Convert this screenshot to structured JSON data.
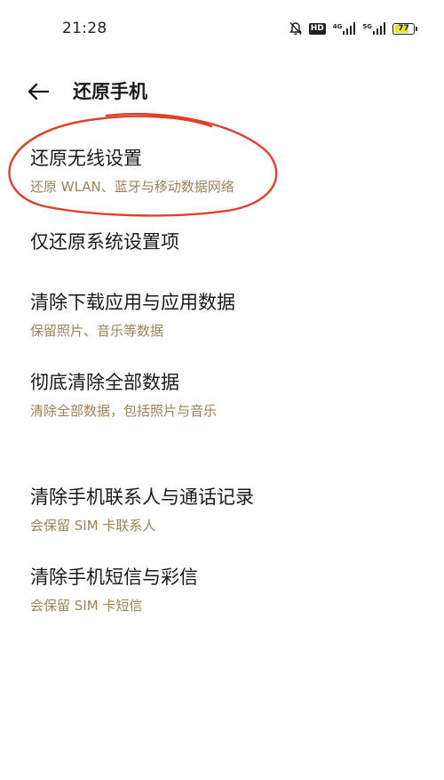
{
  "status_bar": {
    "time": "21:28",
    "hd_label": "HD",
    "net1_label": "4G",
    "net2_label": "5G",
    "battery_level": "77",
    "battery_fraction": 0.77,
    "battery_color": "#e8e432",
    "icons": [
      "bell-mute-icon",
      "hd-icon",
      "signal-4g-icon",
      "signal-5g-icon",
      "battery-icon"
    ]
  },
  "header": {
    "back_icon": "arrow-left-icon",
    "title": "还原手机"
  },
  "items": [
    {
      "title": "还原无线设置",
      "subtitle": "还原 WLAN、蓝牙与移动数据网络"
    },
    {
      "title": "仅还原系统设置项",
      "subtitle": ""
    },
    {
      "title": "清除下载应用与应用数据",
      "subtitle": "保留照片、音乐等数据"
    },
    {
      "title": "彻底清除全部数据",
      "subtitle": "清除全部数据，包括照片与音乐"
    },
    {
      "title": "清除手机联系人与通话记录",
      "subtitle": "会保留 SIM 卡联系人"
    },
    {
      "title": "清除手机短信与彩信",
      "subtitle": "会保留 SIM 卡短信"
    }
  ],
  "colors": {
    "subtitle": "#9b8356",
    "annotation_circle": "#e0402a"
  }
}
